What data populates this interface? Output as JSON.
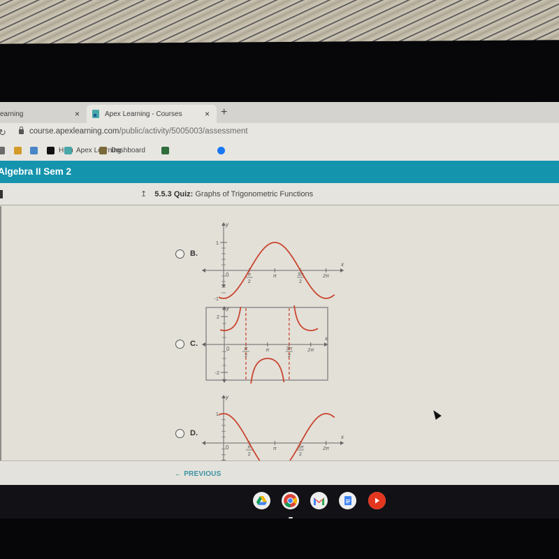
{
  "browser": {
    "tabs": [
      {
        "label": "earning",
        "active": false,
        "close": "×"
      },
      {
        "label": "Apex Learning - Courses",
        "active": true,
        "close": "×"
      }
    ],
    "new_tab": "+",
    "url_host": "course.apexlearning.com",
    "url_path": "/public/activity/5005003/assessment",
    "bookmarks": [
      {
        "label": "",
        "icon": "photos-icon",
        "color": "#6b6b6b"
      },
      {
        "label": "",
        "icon": "chrome-web-store-icon",
        "color": "#d39b2a"
      },
      {
        "label": "",
        "icon": "loader-icon",
        "color": "#4a86c5"
      },
      {
        "label": "Hulu",
        "icon": "hulu-icon",
        "color": "#111111"
      },
      {
        "label": "Apex Learning",
        "icon": "apex-icon",
        "color": "#48a7a9"
      },
      {
        "label": "Dashboard",
        "icon": "dashboard-icon",
        "color": "#7a6a3a"
      },
      {
        "label": "",
        "icon": "extension-icon",
        "color": "#2f6d3a"
      },
      {
        "label": "",
        "icon": "facebook-icon",
        "color": "#1877f2"
      }
    ]
  },
  "course": {
    "title": "Algebra II Sem 2",
    "quiz_number": "5.5.3",
    "quiz_label": "Quiz:",
    "quiz_title": "Graphs of Trigonometric Functions",
    "up_icon": "↥"
  },
  "options": [
    {
      "letter": "B.",
      "selected": false
    },
    {
      "letter": "C.",
      "selected": false
    },
    {
      "letter": "D.",
      "selected": false
    }
  ],
  "footer": {
    "previous_label": "PREVIOUS",
    "arrow": "←"
  },
  "shelf": {
    "apps": [
      {
        "name": "google-drive-icon"
      },
      {
        "name": "chrome-icon",
        "active": true
      },
      {
        "name": "gmail-icon"
      },
      {
        "name": "google-docs-icon"
      },
      {
        "name": "youtube-icon"
      }
    ]
  },
  "colors": {
    "accent": "#1594ad",
    "curve": "#c9452f",
    "link": "#3c93a3"
  },
  "chart_data": [
    {
      "type": "line",
      "option": "B",
      "function": "y = -cos(x)",
      "xlabel": "x",
      "ylabel": "y",
      "x_range": [
        -0.3,
        6.8
      ],
      "ylim": [
        -1,
        1
      ],
      "x_ticks": [
        "0",
        "π/2",
        "π",
        "3π/2",
        "2π"
      ],
      "x_tick_values": [
        0,
        1.5708,
        3.1416,
        4.7124,
        6.2832
      ],
      "y_ticks": [
        "1",
        "-1"
      ],
      "y_tick_values": [
        1,
        -1
      ],
      "series": [
        {
          "name": "curve",
          "x": [
            -0.3,
            0,
            1.5708,
            3.1416,
            4.7124,
            6.2832,
            6.8
          ],
          "y": [
            -0.955,
            -1,
            0,
            1,
            0,
            -1,
            -0.869
          ]
        }
      ]
    },
    {
      "type": "line",
      "option": "C",
      "function": "y = sec(x) + ... (secant-like, minimum 1 near x=0)",
      "xlabel": "x",
      "ylabel": "y",
      "x_range": [
        -0.3,
        6.8
      ],
      "ylim": [
        -2.5,
        2.5
      ],
      "x_ticks": [
        "0",
        "π/2",
        "π",
        "3π/2",
        "2π"
      ],
      "x_tick_values": [
        0,
        1.5708,
        3.1416,
        4.7124,
        6.2832
      ],
      "y_ticks": [
        "2",
        "-2"
      ],
      "y_tick_values": [
        2,
        -2
      ],
      "asymptotes": [
        1.5708,
        4.7124
      ],
      "series": [
        {
          "name": "curve",
          "x": [
            0,
            3.1416,
            6.2832
          ],
          "y": [
            1,
            -1,
            1
          ]
        }
      ]
    },
    {
      "type": "line",
      "option": "D",
      "function": "y = cos(x)",
      "xlabel": "x",
      "ylabel": "y",
      "x_range": [
        -0.3,
        6.8
      ],
      "ylim": [
        -1,
        1
      ],
      "x_ticks": [
        "0",
        "π/2",
        "π",
        "3π/2",
        "2π"
      ],
      "x_tick_values": [
        0,
        1.5708,
        3.1416,
        4.7124,
        6.2832
      ],
      "y_ticks": [
        "1"
      ],
      "y_tick_values": [
        1
      ],
      "series": [
        {
          "name": "curve",
          "x": [
            -0.3,
            0,
            1.5708,
            3.1416,
            4.7124,
            6.2832,
            6.8
          ],
          "y": [
            0.955,
            1,
            0,
            -1,
            0,
            1,
            0.869
          ]
        }
      ]
    }
  ]
}
